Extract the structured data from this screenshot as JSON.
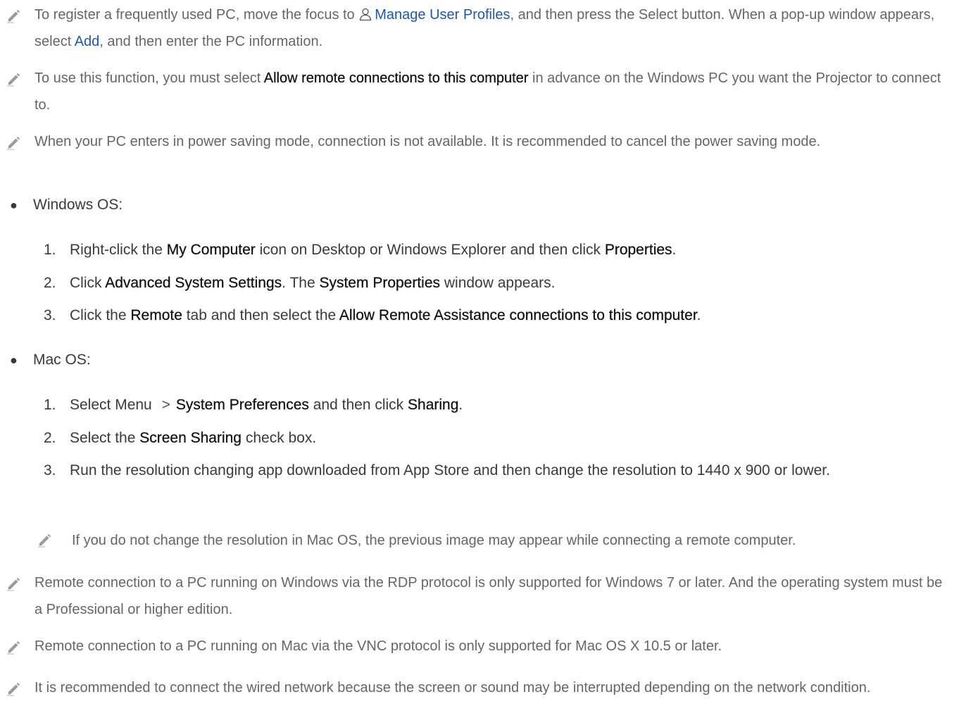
{
  "notes": [
    {
      "s1": "To register a frequently used PC, move the focus to ",
      "link1": "Manage User Profiles",
      "s2": ", and then press the Select button. When a pop-up window appears, select ",
      "link2": "Add",
      "s3": ", and then enter the PC information."
    },
    {
      "s1": "To use this function, you must select ",
      "em1": "Allow remote connections to this computer",
      "s2": " in advance on the Windows PC you want the Projector to connect to."
    },
    {
      "s1": "When your PC enters in power saving mode, connection is not available. It is recommended to cancel the power saving mode."
    }
  ],
  "windows": {
    "label": "Windows OS:",
    "steps": [
      {
        "num": "1.",
        "s1": "Right-click the ",
        "em1": "My Computer",
        "s2": " icon on Desktop or Windows Explorer and then click ",
        "em2": "Properties",
        "s3": "."
      },
      {
        "num": "2.",
        "s1": "Click ",
        "em1": "Advanced System Settings",
        "s2": ". The ",
        "em2": "System Properties",
        "s3": " window appears."
      },
      {
        "num": "3.",
        "s1": "Click the ",
        "em1": "Remote",
        "s2": " tab and then select the ",
        "em2": "Allow Remote Assistance connections to this computer",
        "s3": "."
      }
    ]
  },
  "mac": {
    "label": "Mac OS:",
    "steps": [
      {
        "num": "1.",
        "s1": "Select Menu ",
        "chevron": ">",
        "em1": "System Preferences",
        "s2": " and then click ",
        "em2": "Sharing",
        "s3": "."
      },
      {
        "num": "2.",
        "s1": "Select the ",
        "em1": "Screen Sharing",
        "s2": " check box."
      },
      {
        "num": "3.",
        "s1": "Run the resolution changing app downloaded from App Store and then change the resolution to 1440 x 900 or lower."
      }
    ],
    "subnote": "If you do not change the resolution in Mac OS, the previous image may appear while connecting a remote computer."
  },
  "footer_notes": [
    "Remote connection to a PC running on Windows via the RDP protocol is only supported for Windows 7 or later. And the operating system must be a Professional or higher edition.",
    "Remote connection to a PC running on Mac via the VNC protocol is only supported for Mac OS X 10.5 or later.",
    "It is recommended to connect the wired network because the screen or sound may be interrupted depending on the network condition."
  ],
  "colors": {
    "link": "#1e56b4",
    "note_text": "#666666",
    "body_text": "#3a3a3a",
    "emphasis": "#111111"
  },
  "icons": {
    "note": "pencil-icon",
    "profile": "user-icon",
    "path_separator": "chevron-right-icon"
  }
}
